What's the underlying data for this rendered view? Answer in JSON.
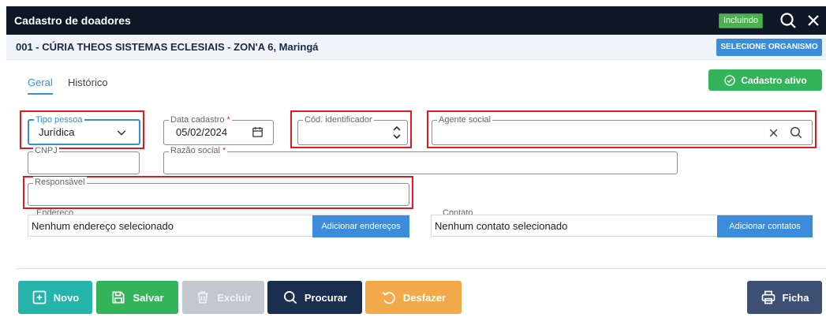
{
  "window": {
    "title": "Cadastro de doadores",
    "status_badge": "Incluindo"
  },
  "organization": {
    "name": "001 - CÚRIA THEOS SISTEMAS ECLESIAIS - ZON'A 6, Maringá",
    "select_button": "SELECIONE ORGANISMO"
  },
  "tabs": [
    {
      "label": "Geral",
      "active": true
    },
    {
      "label": "Histórico",
      "active": false
    }
  ],
  "status_button": "Cadastro ativo",
  "form": {
    "tipo_pessoa": {
      "label": "Tipo pessoa",
      "value": "Jurídica"
    },
    "data_cadastro": {
      "label": "Data cadastro",
      "required": "*",
      "value": "05/02/2024"
    },
    "cod_identificador": {
      "label": "Cód. identificador",
      "value": ""
    },
    "agente_social": {
      "label": "Agente social",
      "value": ""
    },
    "cnpj": {
      "label": "CNPJ",
      "value": ""
    },
    "razao_social": {
      "label": "Razão social",
      "required": "*",
      "value": ""
    },
    "responsavel": {
      "label": "Responsável",
      "value": ""
    },
    "endereco": {
      "label": "Endereço",
      "value": "Nenhum endereço selecionado",
      "button": "Adicionar endereços"
    },
    "contato": {
      "label": "Contato",
      "value": "Nenhum contato selecionado",
      "button": "Adicionar contatos"
    }
  },
  "footer_buttons": [
    {
      "label": "Novo",
      "icon": "plus-square-icon",
      "color": "#26b3a9"
    },
    {
      "label": "Salvar",
      "icon": "save-icon",
      "color": "#34b35a"
    },
    {
      "label": "Excluir",
      "icon": "trash-icon",
      "color": "#c2c8cf"
    },
    {
      "label": "Procurar",
      "icon": "search-icon",
      "color": "#1a2e4f"
    },
    {
      "label": "Desfazer",
      "icon": "undo-icon",
      "color": "#f2a94a"
    },
    {
      "label": "Ficha",
      "icon": "print-icon",
      "color": "#3d4f73"
    }
  ],
  "colors": {
    "titlebar": "#0d1726",
    "accent": "#3a8fd9",
    "highlight": "#e01b24"
  }
}
